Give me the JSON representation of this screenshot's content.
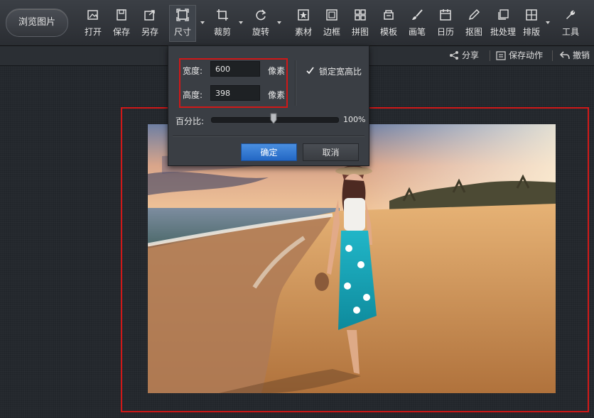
{
  "toolbar": {
    "browse_label": "浏览图片",
    "tools": [
      {
        "label": "打开",
        "icon": "open-icon"
      },
      {
        "label": "保存",
        "icon": "save-icon"
      },
      {
        "label": "另存",
        "icon": "save-as-icon"
      },
      {
        "label": "尺寸",
        "icon": "resize-icon",
        "active": true
      },
      {
        "label": "裁剪",
        "icon": "crop-icon"
      },
      {
        "label": "旋转",
        "icon": "rotate-icon"
      },
      {
        "label": "素材",
        "icon": "material-icon"
      },
      {
        "label": "边框",
        "icon": "border-icon"
      },
      {
        "label": "拼图",
        "icon": "collage-icon"
      },
      {
        "label": "模板",
        "icon": "template-icon"
      },
      {
        "label": "画笔",
        "icon": "brush-icon"
      },
      {
        "label": "日历",
        "icon": "calendar-icon"
      },
      {
        "label": "抠图",
        "icon": "cutout-icon"
      },
      {
        "label": "批处理",
        "icon": "batch-icon"
      },
      {
        "label": "排版",
        "icon": "layout-icon"
      },
      {
        "label": "工具",
        "icon": "wrench-icon"
      }
    ]
  },
  "subbar": {
    "share_label": "分享",
    "save_action_label": "保存动作",
    "undo_label": "撤销"
  },
  "size_panel": {
    "width_label": "宽度:",
    "width_value": "600",
    "width_unit": "像素",
    "height_label": "高度:",
    "height_value": "398",
    "height_unit": "像素",
    "lock_label": "锁定宽高比",
    "lock_checked": true,
    "percent_label": "百分比:",
    "percent_value": "100%",
    "slider_level": 0.5,
    "ok_label": "确定",
    "cancel_label": "取消"
  },
  "colors": {
    "highlight_box": "#d01818",
    "accent_button": "#2f78d4"
  }
}
